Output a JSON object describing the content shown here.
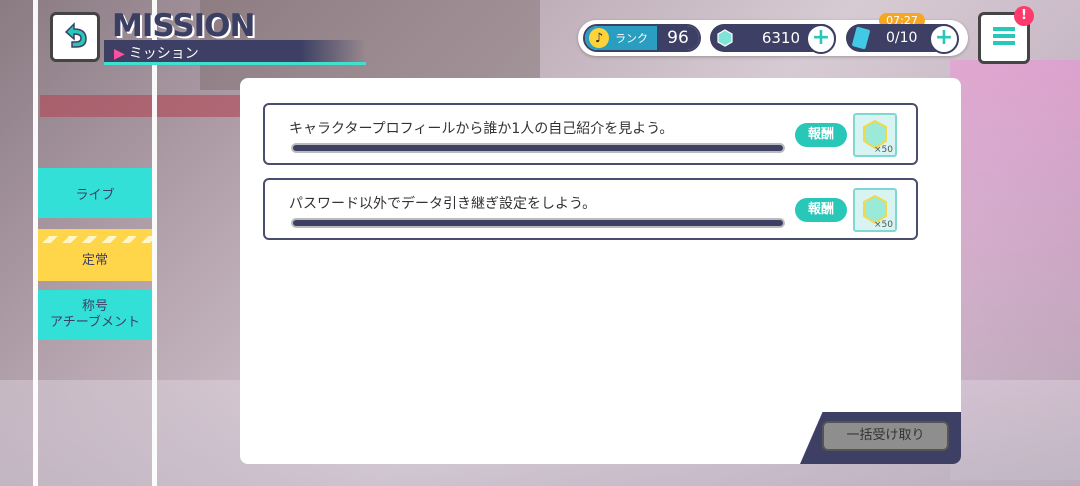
{
  "header": {
    "title": "MISSION",
    "subtitle": "ミッション"
  },
  "status": {
    "rank_label": "ランク",
    "rank_value": "96",
    "gems": "6310",
    "timer": "07:27",
    "tickets": "0/10"
  },
  "tabs": [
    {
      "label": "ライブ"
    },
    {
      "label": "定常"
    },
    {
      "label": "称号\nアチーブメント"
    }
  ],
  "missions": [
    {
      "text": "キャラクタープロフィールから誰か1人の自己紹介を見よう。",
      "reward_label": "報酬",
      "reward_qty": "×50",
      "progress": 0
    },
    {
      "text": "パスワード以外でデータ引き継ぎ設定をしよう。",
      "reward_label": "報酬",
      "reward_qty": "×50",
      "progress": 0
    }
  ],
  "bulk_button": {
    "label": "一括受け取り"
  },
  "colors": {
    "accent": "#33e0d8",
    "navy": "#3d4064",
    "yellow": "#ffd54a",
    "pink": "#ff3b6b"
  },
  "icons": [
    "back-arrow-icon",
    "music-note-icon",
    "gem-icon",
    "plus-icon",
    "ticket-icon",
    "menu-icon",
    "alert-icon"
  ]
}
